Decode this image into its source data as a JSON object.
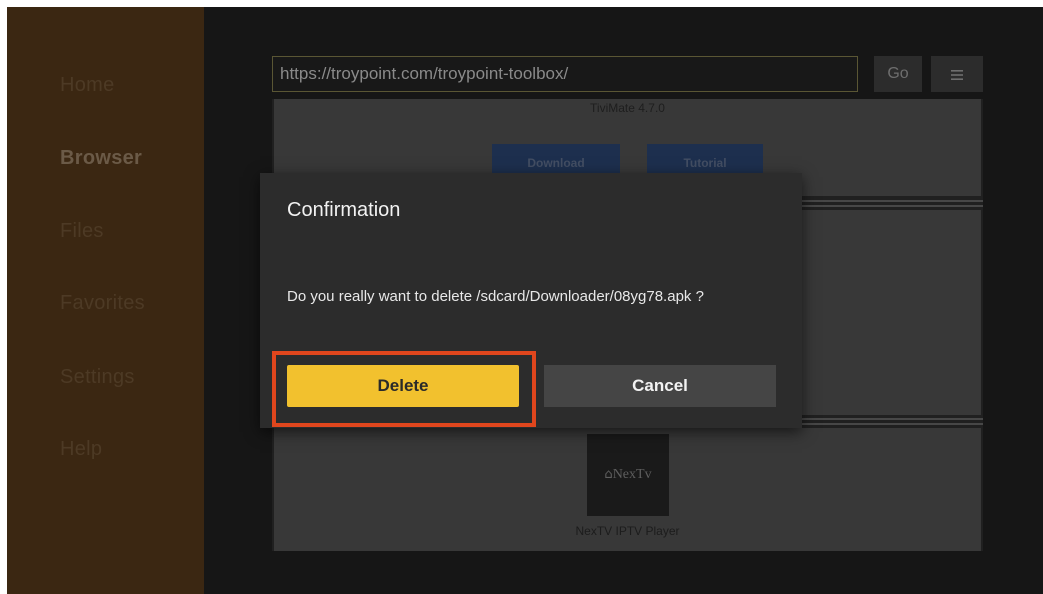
{
  "sidebar": {
    "items": [
      {
        "label": "Home"
      },
      {
        "label": "Browser"
      },
      {
        "label": "Files"
      },
      {
        "label": "Favorites"
      },
      {
        "label": "Settings"
      },
      {
        "label": "Help"
      }
    ],
    "active": "Browser"
  },
  "browser": {
    "url": "https://troypoint.com/troypoint-toolbox/",
    "go_label": "Go",
    "menu_icon": "hamburger-menu-icon",
    "page": {
      "card1_title": "TiviMate 4.7.0",
      "download_label": "Download",
      "tutorial_label": "Tutorial",
      "nextv_logo_text": "NexTv",
      "nextv_caption": "NexTV IPTV Player"
    }
  },
  "dialog": {
    "title": "Confirmation",
    "message": "Do you really want to delete /sdcard/Downloader/08yg78.apk ?",
    "delete_label": "Delete",
    "cancel_label": "Cancel"
  },
  "colors": {
    "sidebar_bg": "#3b2712",
    "delete_button": "#f2c12e",
    "highlight_border": "#e0461d",
    "dialog_bg": "#2c2c2c"
  }
}
